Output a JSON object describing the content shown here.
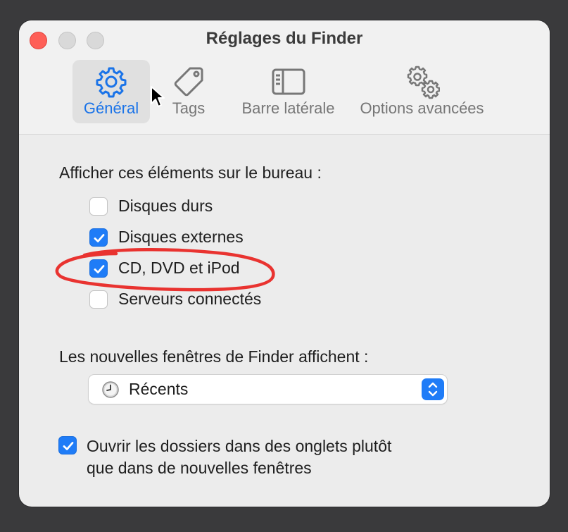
{
  "window": {
    "title": "Réglages du Finder"
  },
  "tabs": [
    {
      "label": "Général",
      "icon": "gear-icon",
      "active": true
    },
    {
      "label": "Tags",
      "icon": "tag-icon",
      "active": false
    },
    {
      "label": "Barre latérale",
      "icon": "sidebar-icon",
      "active": false
    },
    {
      "label": "Options avancées",
      "icon": "gears-icon",
      "active": false
    }
  ],
  "desktop": {
    "label": "Afficher ces éléments sur le bureau :",
    "items": [
      {
        "label": "Disques durs",
        "checked": false
      },
      {
        "label": "Disques externes",
        "checked": true
      },
      {
        "label": "CD, DVD et iPod",
        "checked": true
      },
      {
        "label": "Serveurs connectés",
        "checked": false
      }
    ]
  },
  "new_windows": {
    "label": "Les nouvelles fenêtres de Finder affichent :",
    "selected": "Récents",
    "icon": "clock-icon"
  },
  "tabs_option": {
    "label_line1": "Ouvrir les dossiers dans des onglets plutôt",
    "label_line2": "que dans de nouvelles fenêtres",
    "checked": true
  },
  "colors": {
    "accent": "#1f7cf7",
    "annotation": "#e8231f",
    "close": "#fe5f57"
  }
}
